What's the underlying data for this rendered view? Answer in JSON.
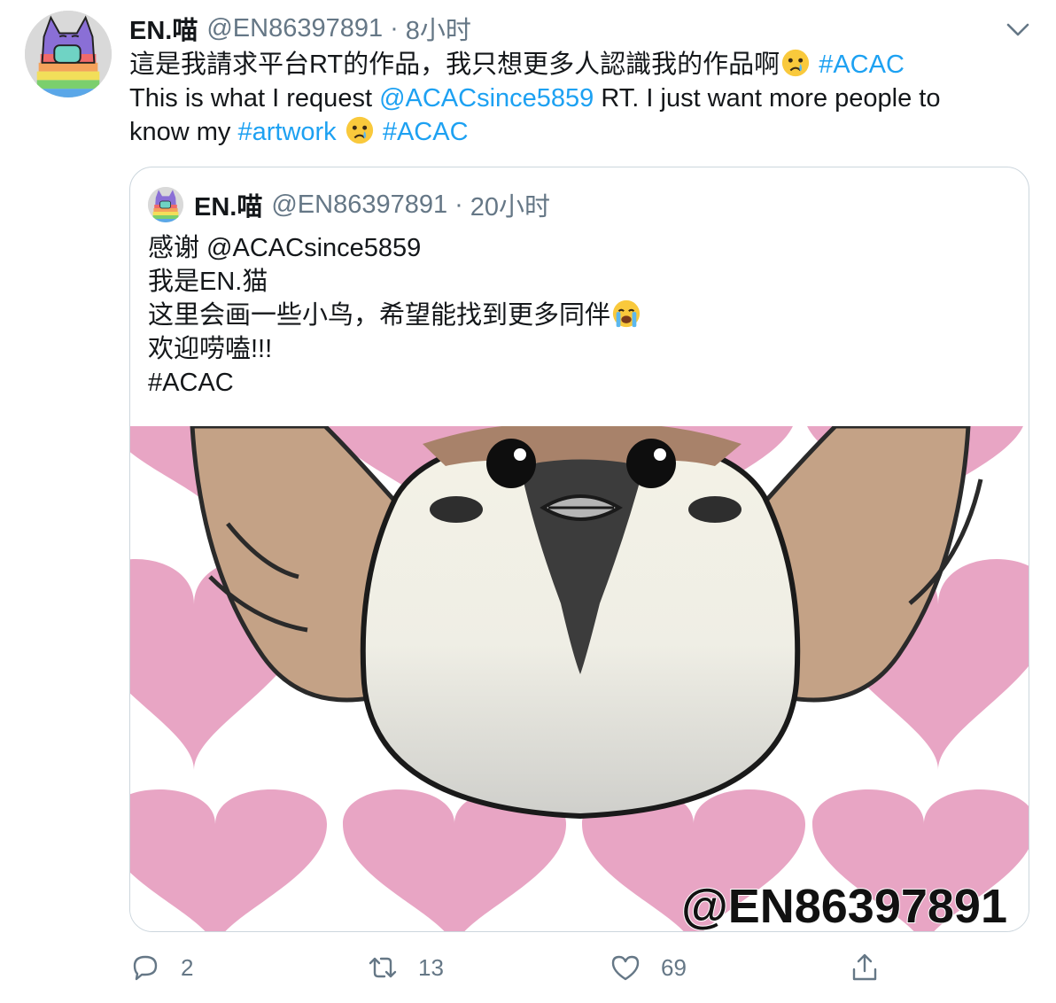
{
  "tweet": {
    "author_name": "EN.喵",
    "author_handle": "@EN86397891",
    "separator": "·",
    "time": "8小时",
    "avatar_icon": "cat-avatar-icon",
    "menu_icon": "chevron-down-icon",
    "line1_text": "這是我請求平台RT的作品，我只想更多人認識我的作品啊",
    "line1_hashtag": "#ACAC",
    "line2_prefix": "This is what I request ",
    "line2_mention": "@ACACsince5859",
    "line2_suffix": " RT. I just want more people to",
    "line3_prefix": "know my ",
    "line3_hashtag1": "#artwork",
    "line3_hashtag2": "#ACAC",
    "emoji": "crying-face-emoji"
  },
  "quoted": {
    "author_name": "EN.喵",
    "author_handle": "@EN86397891",
    "separator": "·",
    "time": "20小时",
    "lines": [
      "感谢 @ACACsince5859",
      "我是EN.猫",
      "这里会画一些小鸟，希望能找到更多同伴",
      "欢迎唠嗑!!!",
      "#ACAC"
    ],
    "emoji": "loudly-crying-face-emoji",
    "image": {
      "subject": "sparrow-illustration",
      "watermark": "@EN86397891"
    }
  },
  "actions": {
    "reply_count": "2",
    "retweet_count": "13",
    "like_count": "69",
    "reply_icon": "reply-icon",
    "retweet_icon": "retweet-icon",
    "like_icon": "heart-icon",
    "share_icon": "share-icon"
  },
  "colors": {
    "link": "#1da1f2",
    "muted": "#657786",
    "border": "#ccd6dd",
    "heart_pink": "#e8a5c4",
    "wing_brown": "#c4a286"
  }
}
